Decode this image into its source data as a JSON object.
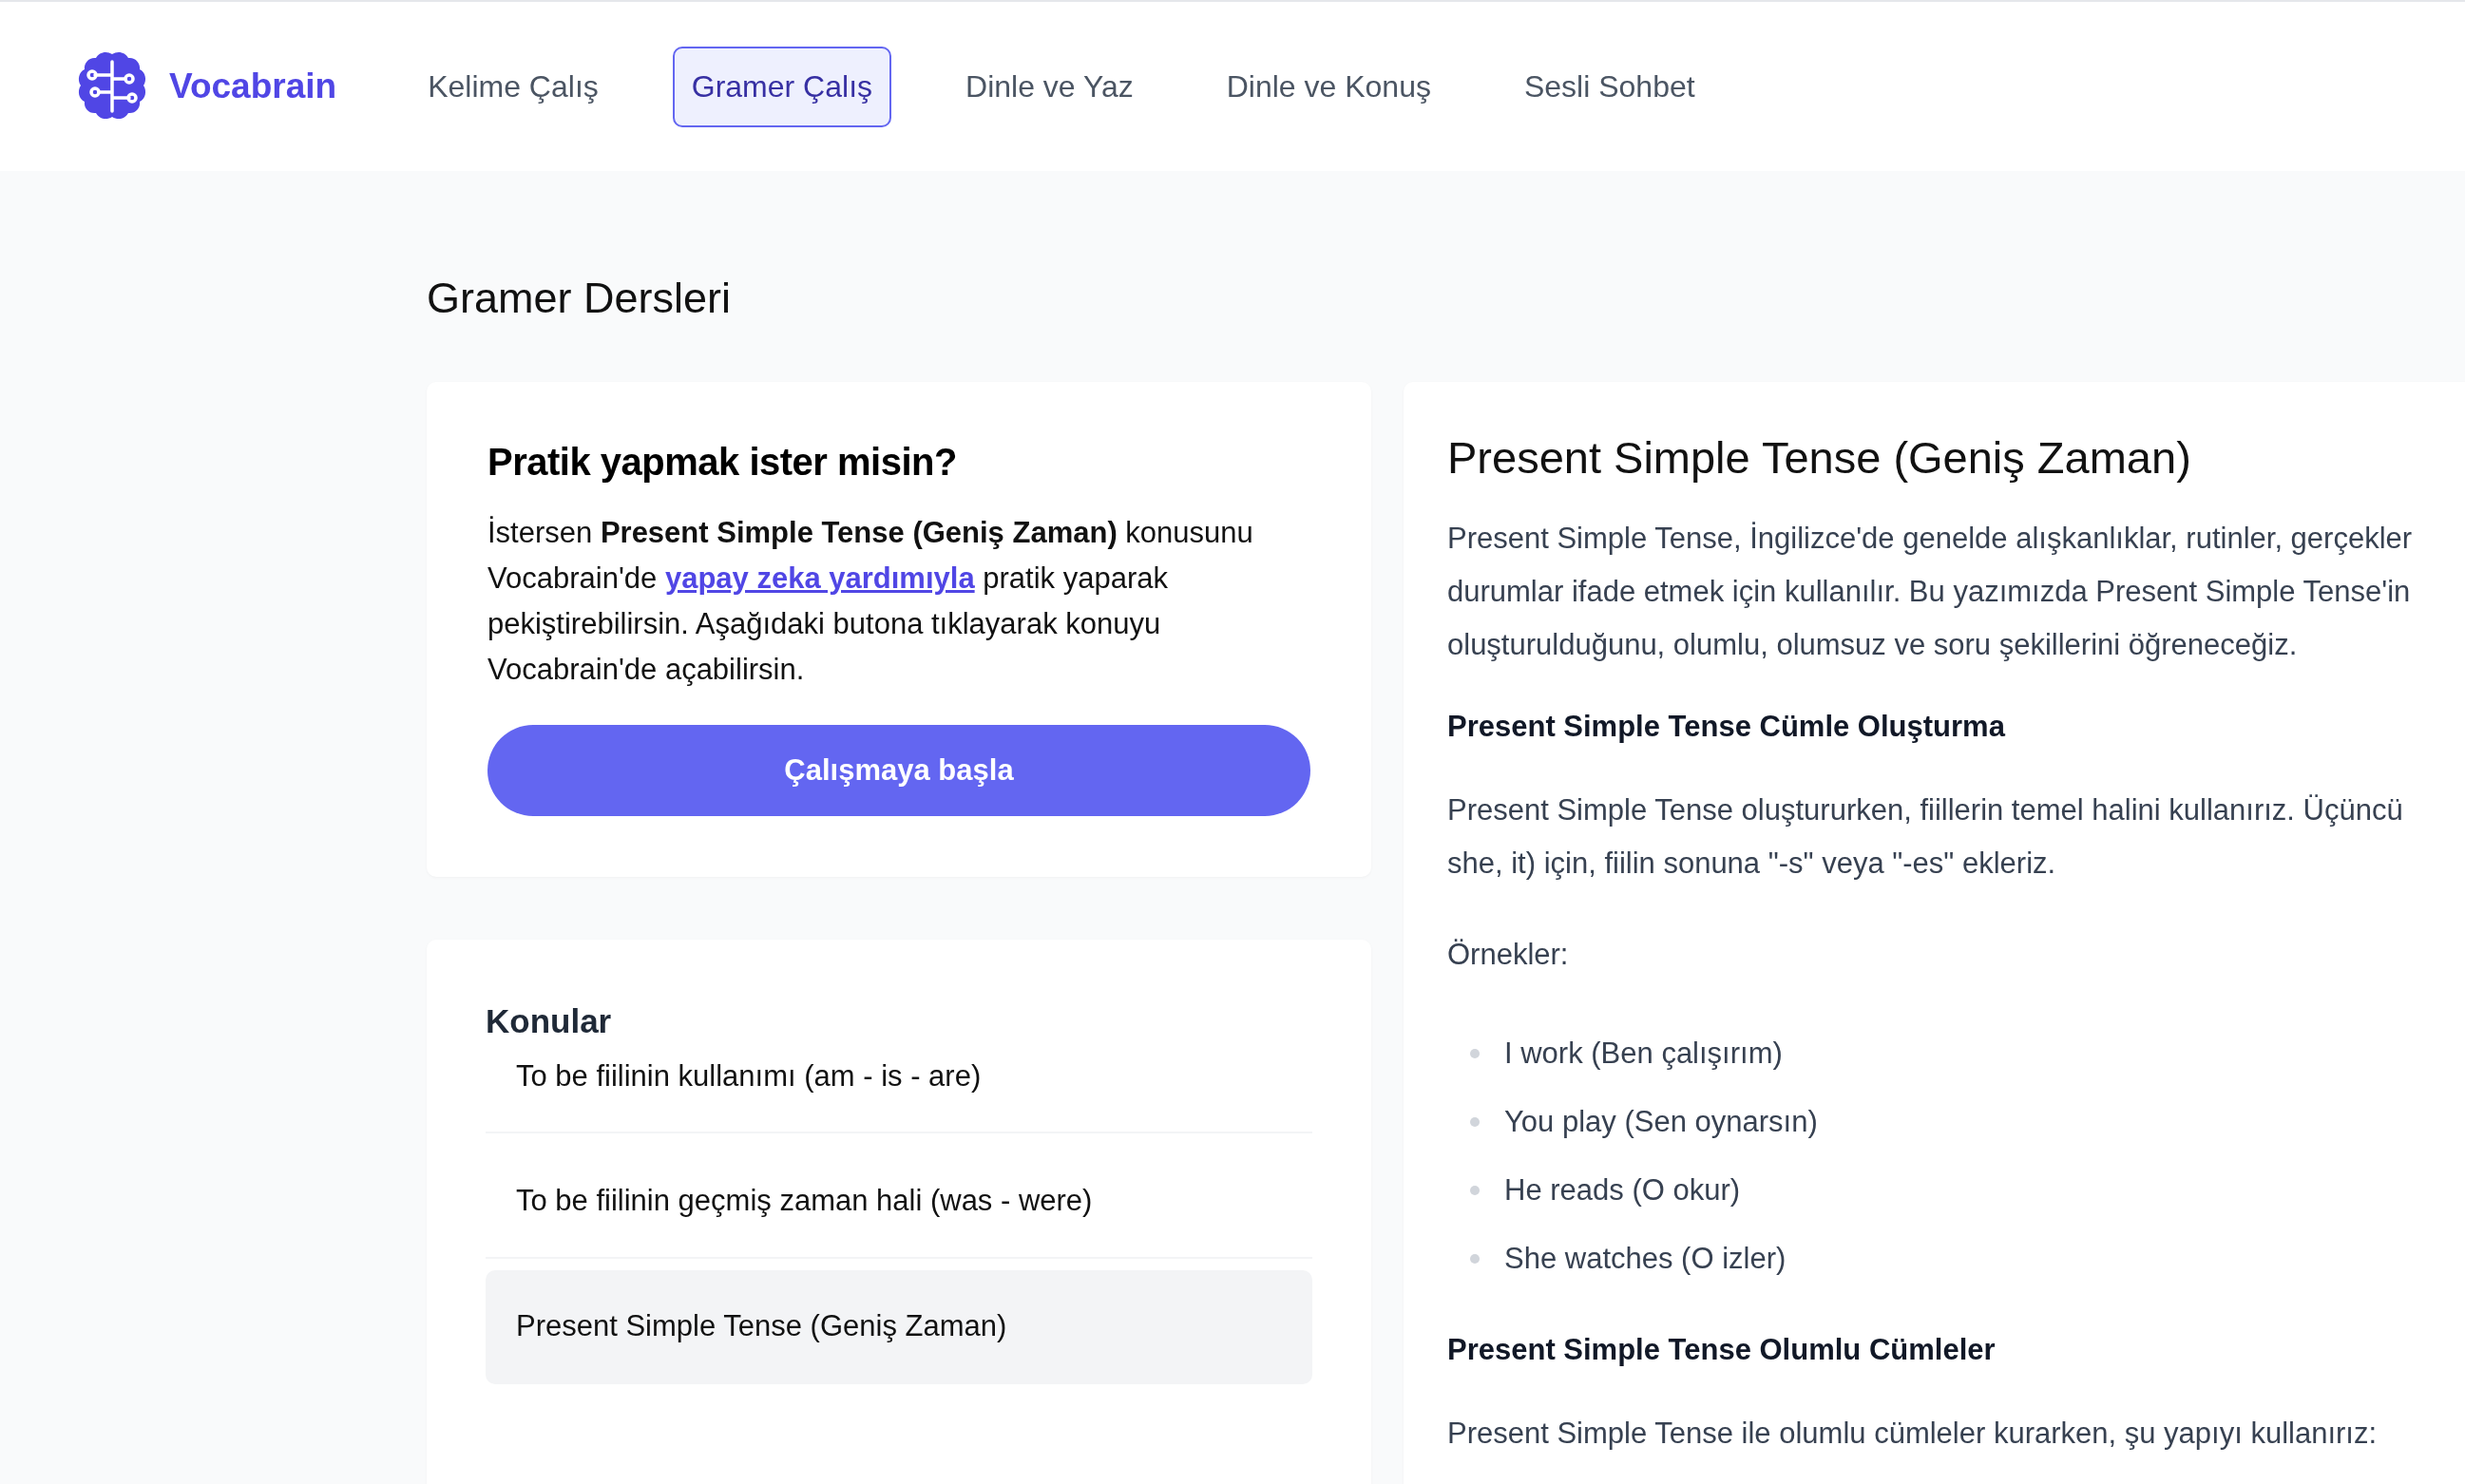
{
  "brand": {
    "name": "Vocabrain"
  },
  "nav": [
    {
      "label": "Kelime Çalış",
      "selected": false
    },
    {
      "label": "Gramer Çalış",
      "selected": true
    },
    {
      "label": "Dinle ve Yaz",
      "selected": false
    },
    {
      "label": "Dinle ve Konuş",
      "selected": false
    },
    {
      "label": "Sesli Sohbet",
      "selected": false
    }
  ],
  "page_title": "Gramer Dersleri",
  "practice_card": {
    "title": "Pratik yapmak ister misin?",
    "text_before": "İstersen **Present Simple Tense (Geniş Zaman)** konusunu Vocabrain'de",
    "link": "yapay zeka yardımıyla",
    "text_after": "pratik yaparak pekiştirebilirsin. Aşağıdaki butona tıklayarak konuyu Vocabrain'de açabilirsin.",
    "button": "Çalışmaya başla"
  },
  "topics": {
    "title": "Konular",
    "items": [
      {
        "label": "To be fiilinin kullanımı (am - is - are)",
        "selected": false
      },
      {
        "label": "To be fiilinin geçmiş zaman hali (was - were)",
        "selected": false
      },
      {
        "label": "Present Simple Tense (Geniş Zaman)",
        "selected": true
      }
    ]
  },
  "article": {
    "title": "Present Simple Tense (Geniş Zaman)",
    "blocks": [
      {
        "kind": "paragraph",
        "lines": [
          "Present Simple Tense, İngilizce'de genelde alışkanlıklar, rutinler, gerçekler",
          "durumlar ifade etmek için kullanılır. Bu yazımızda Present Simple Tense'in",
          "oluşturulduğunu, olumlu, olumsuz ve soru şekillerini öğreneceğiz."
        ]
      },
      {
        "kind": "heading",
        "text": "Present Simple Tense Cümle Oluşturma"
      },
      {
        "kind": "paragraph",
        "lines": [
          "Present Simple Tense oluştururken, fiillerin temel halini kullanırız. Üçüncü",
          "she, it) için, fiilin sonuna \"-s\" veya \"-es\" ekleriz."
        ]
      },
      {
        "kind": "paragraph",
        "lines": [
          "Örnekler:"
        ]
      },
      {
        "kind": "list",
        "items": [
          "I work (Ben çalışırım)",
          "You play (Sen oynarsın)",
          "He reads (O okur)",
          "She watches (O izler)"
        ]
      },
      {
        "kind": "heading",
        "text": "Present Simple Tense Olumlu Cümleler"
      },
      {
        "kind": "paragraph",
        "lines": [
          "Present Simple Tense ile olumlu cümleler kurarken, şu yapıyı kullanırız:"
        ]
      }
    ]
  }
}
